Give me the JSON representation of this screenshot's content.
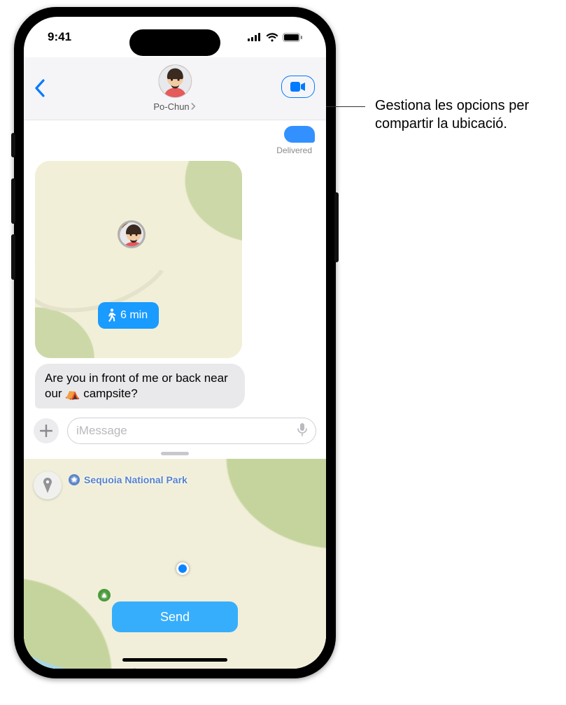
{
  "status": {
    "time": "9:41"
  },
  "header": {
    "contact_name": "Po-Chun"
  },
  "conversation": {
    "delivered_label": "Delivered",
    "walk_eta": "6 min",
    "incoming_text_before": "Are you in front of me or back near our ",
    "incoming_text_after": " campsite?",
    "tent_emoji": "⛺"
  },
  "input": {
    "placeholder": "iMessage"
  },
  "map_sheet": {
    "park_label": "Sequoia National Park",
    "send_label": "Send"
  },
  "callout": {
    "text": "Gestiona les opcions per compartir la ubicació."
  }
}
